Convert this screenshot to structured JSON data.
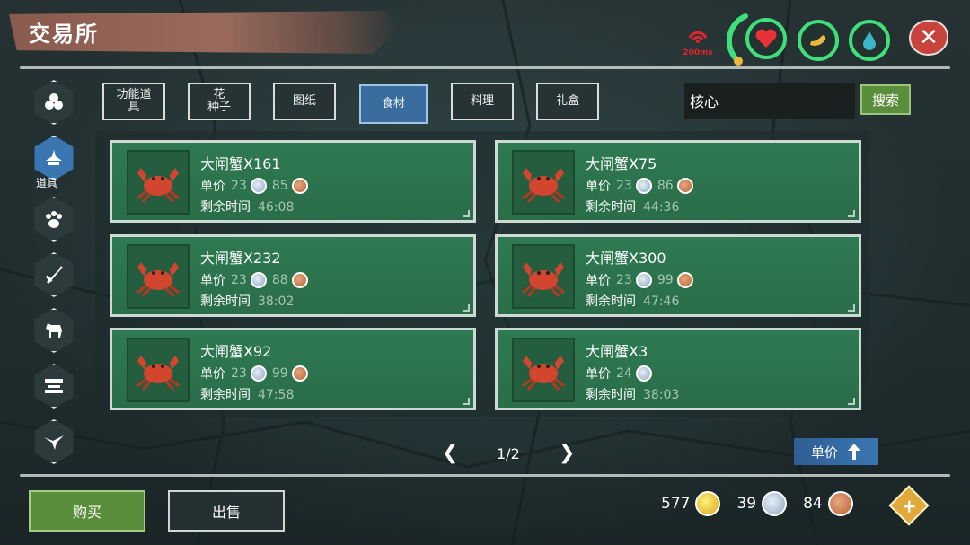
{
  "header": {
    "title": "交易所"
  },
  "status": {
    "ping": "200ms",
    "colors": {
      "ring": "#3fe07a",
      "health": "#e8323a",
      "hunger": "#e8b93a",
      "water": "#3ab6c8"
    }
  },
  "side_nav": {
    "items": [
      {
        "icon": "resources-icon",
        "label": ""
      },
      {
        "icon": "tools-icon",
        "label": "道具",
        "active": true
      },
      {
        "icon": "paw-icon",
        "label": ""
      },
      {
        "icon": "weapon-icon",
        "label": ""
      },
      {
        "icon": "horse-icon",
        "label": ""
      },
      {
        "icon": "furniture-icon",
        "label": ""
      },
      {
        "icon": "bird-icon",
        "label": ""
      }
    ]
  },
  "tabs": [
    {
      "line1": "功能道",
      "line2": "具"
    },
    {
      "line1": "花",
      "line2": "种子"
    },
    {
      "line1": "图纸",
      "line2": ""
    },
    {
      "line1": "食材",
      "line2": "",
      "active": true
    },
    {
      "line1": "料理",
      "line2": ""
    },
    {
      "line1": "礼盒",
      "line2": ""
    }
  ],
  "search": {
    "value": "核心",
    "button": "搜索"
  },
  "listings": [
    {
      "name": "大闸蟹X161",
      "price_label": "单价",
      "silver": "23",
      "bronze": "85",
      "time_label": "剩余时间",
      "time": "46:08"
    },
    {
      "name": "大闸蟹X75",
      "price_label": "单价",
      "silver": "23",
      "bronze": "86",
      "time_label": "剩余时间",
      "time": "44:36"
    },
    {
      "name": "大闸蟹X232",
      "price_label": "单价",
      "silver": "23",
      "bronze": "88",
      "time_label": "剩余时间",
      "time": "38:02"
    },
    {
      "name": "大闸蟹X300",
      "price_label": "单价",
      "silver": "23",
      "bronze": "99",
      "time_label": "剩余时间",
      "time": "47:46"
    },
    {
      "name": "大闸蟹X92",
      "price_label": "单价",
      "silver": "23",
      "bronze": "99",
      "time_label": "剩余时间",
      "time": "47:58"
    },
    {
      "name": "大闸蟹X3",
      "price_label": "单价",
      "silver": "24",
      "bronze": "",
      "time_label": "剩余时间",
      "time": "38:03"
    }
  ],
  "pager": {
    "text": "1/2"
  },
  "sort": {
    "label": "单价"
  },
  "bottom": {
    "buy": "购买",
    "sell": "出售"
  },
  "wallet": {
    "gold": "577",
    "silver": "39",
    "bronze": "84"
  }
}
